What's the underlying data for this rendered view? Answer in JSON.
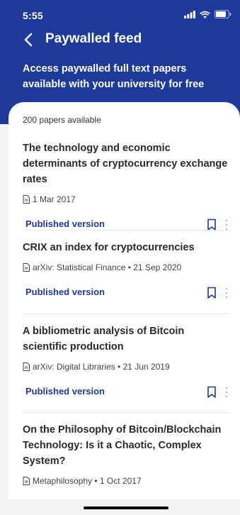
{
  "status_bar": {
    "time": "5:55"
  },
  "nav": {
    "title": "Paywalled feed",
    "back_icon": "chevron-left-icon"
  },
  "header": {
    "subtitle": "Access paywalled full text papers available with your university for free"
  },
  "feed": {
    "count_text": "200 papers available",
    "papers": [
      {
        "title": "The technology and economic determinants of cryptocurrency exchange rates",
        "meta": "1 Mar 2017",
        "action": "Published version"
      },
      {
        "title": "CRIX an index for cryptocurrencies",
        "meta": "arXiv: Statistical Finance • 21 Sep 2020",
        "action": "Published version"
      },
      {
        "title": "A bibliometric analysis of Bitcoin scientific production",
        "meta": "arXiv: Digital Libraries • 21 Jun 2019",
        "action": "Published version"
      },
      {
        "title": "On the Philosophy of Bitcoin/Blockchain Technology: Is it a Chaotic, Complex System?",
        "meta": "Metaphilosophy • 1 Oct 2017"
      }
    ]
  },
  "colors": {
    "brand": "#1d3a9b",
    "background": "#f3f3f5",
    "card": "#ffffff",
    "divider": "#e3e3e3"
  }
}
